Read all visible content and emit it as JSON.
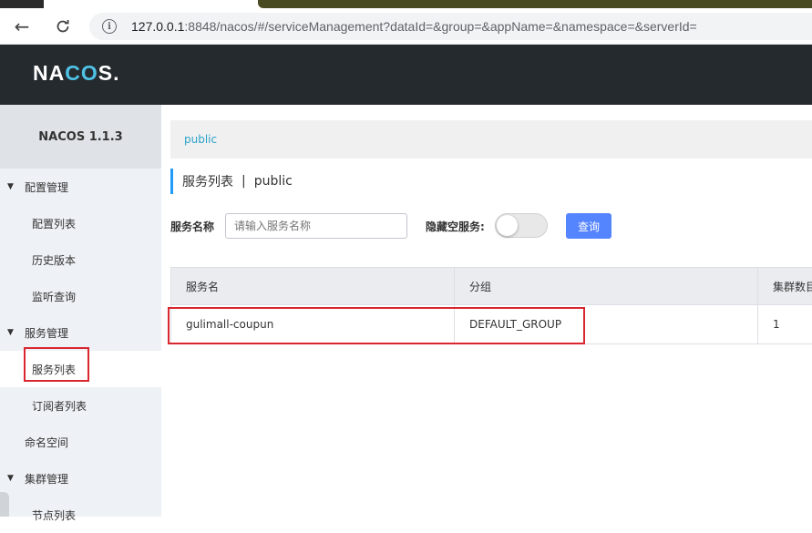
{
  "browser": {
    "url_host": "127.0.0.1",
    "url_rest": ":8848/nacos/#/serviceManagement?dataId=&group=&appName=&namespace=&serverId="
  },
  "header": {
    "logo_pre": "NA",
    "logo_co": "CO",
    "logo_post": "S."
  },
  "sidebar": {
    "version": "NACOS 1.1.3",
    "items": [
      {
        "label": "配置管理"
      },
      {
        "label": "配置列表"
      },
      {
        "label": "历史版本"
      },
      {
        "label": "监听查询"
      },
      {
        "label": "服务管理"
      },
      {
        "label": "服务列表"
      },
      {
        "label": "订阅者列表"
      },
      {
        "label": "命名空间"
      },
      {
        "label": "集群管理"
      },
      {
        "label": "节点列表"
      }
    ]
  },
  "main": {
    "namespace_tab": "public",
    "title": "服务列表",
    "title_sep": "|",
    "title_ns": "public",
    "service_name_label": "服务名称",
    "service_name_placeholder": "请输入服务名称",
    "hide_empty_label": "隐藏空服务:",
    "query_button": "查询",
    "table": {
      "headers": [
        "服务名",
        "分组",
        "集群数目"
      ],
      "rows": [
        [
          "gulimall-coupun",
          "DEFAULT_GROUP",
          "1"
        ]
      ]
    }
  },
  "colors": {
    "accent": "#5584ff",
    "header_bg": "#252a2f",
    "highlight": "#d9262f"
  }
}
